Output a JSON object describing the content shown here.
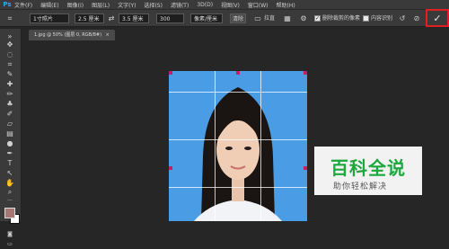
{
  "app": {
    "logo": "Ps"
  },
  "menubar": {
    "items": [
      "文件(F)",
      "编辑(E)",
      "图像(I)",
      "图层(L)",
      "文字(Y)",
      "选择(S)",
      "滤镜(T)",
      "3D(D)",
      "视图(V)",
      "窗口(W)",
      "帮助(H)"
    ]
  },
  "options": {
    "ratio_label": "1寸照片",
    "width_value": "2.5 厘米",
    "swap_icon": "⇄",
    "height_value": "3.5 厘米",
    "resolution_value": "300",
    "resolution_unit": "像素/厘米",
    "clear_button": "清除",
    "straighten_label": "拉直",
    "delete_cropped_label": "删除裁剪的像素",
    "content_aware_label": "内容识别",
    "confirm_icon": "check-icon",
    "cancel_icon": "cancel-icon",
    "reset_icon": "reset-icon"
  },
  "document": {
    "tab_title": "1.jpg @ 50% (图层 0, RGB/8#)",
    "close": "×"
  },
  "colors": {
    "foreground": "#a77773",
    "background": "#ffffff",
    "canvas_bg": "#4a9de5",
    "accent": "#31a8ff",
    "confirm_border": "#e02020"
  },
  "watermark": {
    "title": "百科全说",
    "subtitle": "助你轻松解决"
  }
}
